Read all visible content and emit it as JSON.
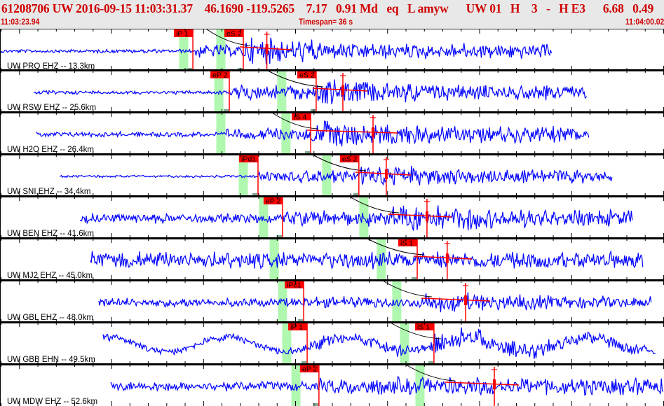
{
  "header": {
    "title": "61208706 UW 2016-09-15 11:03:31.37    46.1690 -119.5265    7.17   0.91 Md   eq   L amyw      UW 01   H    3   -   H E3      6.68   0.49",
    "start_time": "11:03:23.94",
    "timespan": "Timespan=  36 s",
    "end_time": "11:04:00.02"
  },
  "window": {
    "start_seconds": 23.94,
    "span_seconds": 36.08
  },
  "colors": {
    "trace": "#0000ff",
    "pick": "#ff0000",
    "window": "#b0f8b0",
    "header_text": "#d00000"
  },
  "traces": [
    {
      "label": "UW PRO EHZ -- 13.3km",
      "data_start": 0.0,
      "data_end": 30.0,
      "picks": [
        {
          "label": "iP 1",
          "t": 10.48
        },
        {
          "label": "eS 2",
          "t": 13.22
        }
      ],
      "windows": [
        9.98,
        12.0
      ],
      "amp_t": 14.5
    },
    {
      "label": "UW RSW EHZ -- 25.6km",
      "data_start": 1.83,
      "data_end": 31.9,
      "picks": [
        {
          "label": "eP 2",
          "t": 12.46
        },
        {
          "label": "eS 2",
          "t": 17.18
        }
      ],
      "windows": [
        11.89,
        15.31
      ],
      "amp_t": 18.63
    },
    {
      "label": "UW H2O EHZ -- 26.4km",
      "data_start": 1.98,
      "data_end": 32.0,
      "picks": [
        {
          "label": "iS 4",
          "t": 16.88
        }
      ],
      "windows": [
        12.0,
        15.54
      ],
      "amp_t": 20.27
    },
    {
      "label": "UW SNI,EHZ -- 34.4km",
      "data_start": 3.24,
      "data_end": 33.26,
      "picks": [
        {
          "label": "iPd1",
          "t": 14.02
        },
        {
          "label": "eS 2",
          "t": 19.5
        }
      ],
      "windows": [
        13.22,
        17.75
      ],
      "amp_t": 20.99
    },
    {
      "label": "UW BEN EHZ -- 41.6km",
      "data_start": 4.34,
      "data_end": 34.36,
      "picks": [
        {
          "label": "eP 2",
          "t": 15.35
        }
      ],
      "windows": [
        14.32,
        19.77
      ],
      "amp_t": 23.2
    },
    {
      "label": "UW MJ2 EHZ -- 45.0km",
      "data_start": 4.91,
      "data_end": 34.93,
      "picks": [
        {
          "label": "iS 1",
          "t": 22.67
        }
      ],
      "windows": [
        14.9,
        20.72
      ],
      "amp_t": 24.3
    },
    {
      "label": "UW GBL EHZ -- 48.0km",
      "data_start": 5.37,
      "data_end": 35.43,
      "picks": [
        {
          "label": "iPc1",
          "t": 16.5
        }
      ],
      "windows": [
        15.35,
        21.56
      ],
      "amp_t": 25.3
    },
    {
      "label": "UW GBB EHN -- 49.5km",
      "data_start": 5.6,
      "data_end": 35.62,
      "picks": [
        {
          "label": "iP 1",
          "t": 16.69
        },
        {
          "label": "iS 1",
          "t": 23.58
        }
      ],
      "windows": [
        15.58,
        21.98
      ],
      "amp_t": null
    },
    {
      "label": "UW MDW EHZ -- 52.6km",
      "data_start": 6.02,
      "data_end": 36.05,
      "picks": [
        {
          "label": "eP 2",
          "t": 17.33
        }
      ],
      "windows": [
        16.08,
        22.82
      ],
      "amp_t": 26.86
    }
  ]
}
